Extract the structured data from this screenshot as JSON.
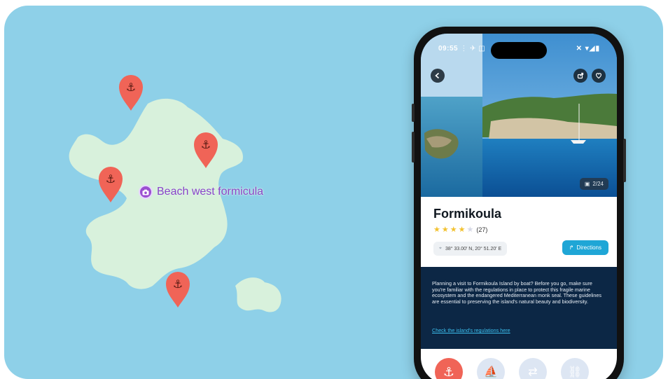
{
  "colors": {
    "sea": "#8ed0e8",
    "land": "#d8f1dc",
    "pin": "#f06457",
    "poi": "#9a4fd0",
    "accent": "#1fa6d6"
  },
  "map": {
    "poi_label": "Beach west formicula",
    "poi_icon": "camera-icon",
    "pin_icon": "anchor-icon"
  },
  "phone": {
    "status": {
      "time": "09:55",
      "left_icons": "⋮ ✈ ◫",
      "right_icons": "✕ ▾◢▮"
    },
    "photo_counter": "2/24",
    "place": {
      "title": "Formikoula",
      "rating_count": "(27)",
      "stars": 4,
      "coordinates": "38° 33.00′ N, 20° 51.20′ E",
      "directions_label": "Directions"
    },
    "description": "Planning a visit to Formikoula Island by boat? Before you go, make sure you're familiar with the regulations in place to protect this fragile marine ecosystem and the endangered Mediterranean monk seal. These guidelines are essential to preserving the island's natural beauty and biodiversity.",
    "link_text": "Check the island's regulations here",
    "tabs": [
      "anchor-icon",
      "boat-icon",
      "dock-icon",
      "link-icon"
    ]
  }
}
